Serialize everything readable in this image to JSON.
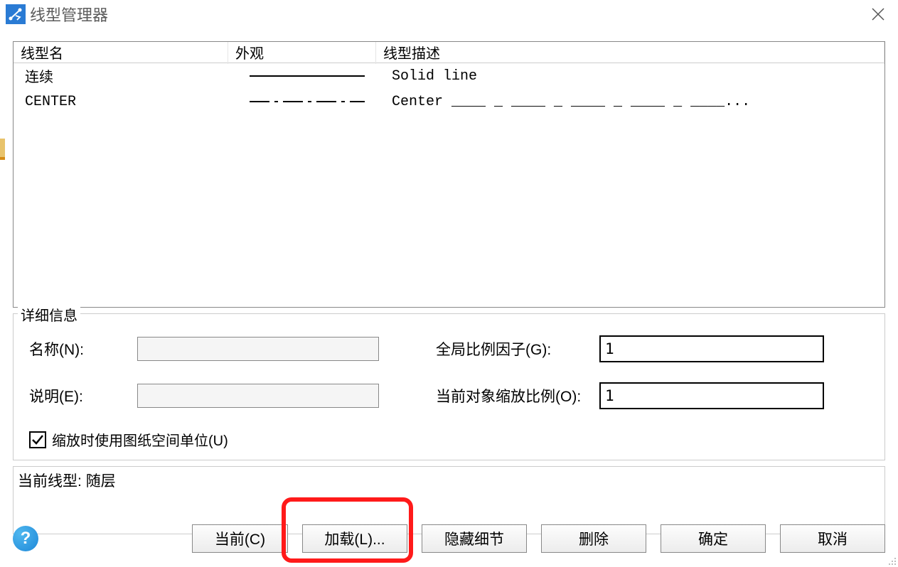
{
  "window": {
    "title": "线型管理器"
  },
  "table": {
    "headers": {
      "name": "线型名",
      "appearance": "外观",
      "description": "线型描述"
    },
    "rows": [
      {
        "name": "连续",
        "style": "solid",
        "description": "Solid line"
      },
      {
        "name": "CENTER",
        "style": "center",
        "description": "Center ____ _ ____ _ ____ _ ____ _ ____..."
      }
    ]
  },
  "details": {
    "legend": "详细信息",
    "name_label": "名称(N):",
    "name_value": "",
    "desc_label": "说明(E):",
    "desc_value": "",
    "global_scale_label": "全局比例因子(G):",
    "global_scale_value": "1",
    "object_scale_label": "当前对象缩放比例(O):",
    "object_scale_value": "1",
    "paperspace_checkbox": "缩放时使用图纸空间单位(U)",
    "paperspace_checked": true
  },
  "current_linetype": {
    "label": "当前线型:",
    "value": "随层"
  },
  "buttons": {
    "current": "当前(C)",
    "load": "加载(L)...",
    "hide_details": "隐藏细节",
    "delete": "删除",
    "ok": "确定",
    "cancel": "取消"
  }
}
